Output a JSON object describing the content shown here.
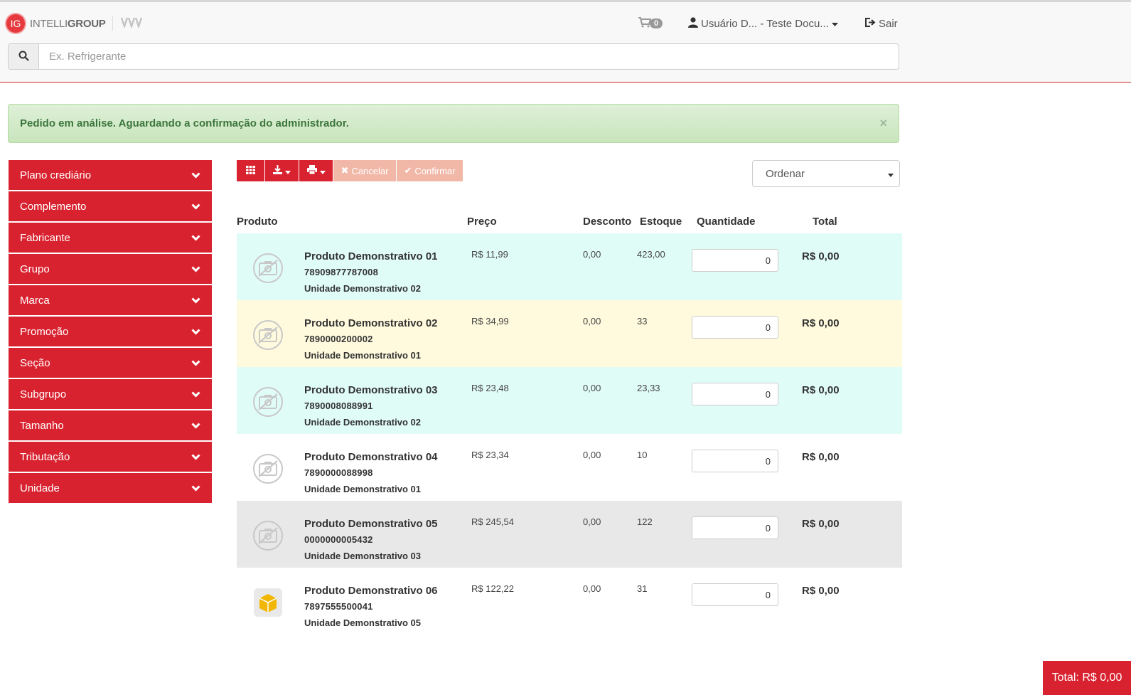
{
  "header": {
    "brand_initials": "IG",
    "brand_name_light": "INTELLI",
    "brand_name_bold": "GROUP",
    "cart_count": "0",
    "user_label": "Usuário D... - Teste Docu...",
    "logout_label": "Sair"
  },
  "search": {
    "placeholder": "Ex. Refrigerante"
  },
  "alert": {
    "message": "Pedido em análise. Aguardando a confirmação do administrador.",
    "close": "×"
  },
  "sidebar": {
    "items": [
      {
        "label": "Plano crediário"
      },
      {
        "label": "Complemento"
      },
      {
        "label": "Fabricante"
      },
      {
        "label": "Grupo"
      },
      {
        "label": "Marca"
      },
      {
        "label": "Promoção"
      },
      {
        "label": "Seção"
      },
      {
        "label": "Subgrupo"
      },
      {
        "label": "Tamanho"
      },
      {
        "label": "Tributação"
      },
      {
        "label": "Unidade"
      }
    ]
  },
  "toolbar": {
    "cancel_label": "Cancelar",
    "confirm_label": "Confirmar",
    "order_label": "Ordenar"
  },
  "table": {
    "headers": {
      "product": "Produto",
      "price": "Preço",
      "discount": "Desconto",
      "stock": "Estoque",
      "quantity": "Quantidade",
      "total": "Total"
    },
    "rows": [
      {
        "name": "Produto Demonstrativo 01",
        "code": "78909877787008",
        "unit": "Unidade Demonstrativo 02",
        "price": "R$ 11,99",
        "discount": "0,00",
        "stock": "423,00",
        "qty": "0",
        "total": "R$ 0,00",
        "bg": "#e0fcf7",
        "icon": "no-image-icon"
      },
      {
        "name": "Produto Demonstrativo 02",
        "code": "7890000200002",
        "unit": "Unidade Demonstrativo 01",
        "price": "R$ 34,99",
        "discount": "0,00",
        "stock": "33",
        "qty": "0",
        "total": "R$ 0,00",
        "bg": "#fffadd",
        "icon": "no-image-icon"
      },
      {
        "name": "Produto Demonstrativo 03",
        "code": "7890008088991",
        "unit": "Unidade Demonstrativo 02",
        "price": "R$ 23,48",
        "discount": "0,00",
        "stock": "23,33",
        "qty": "0",
        "total": "R$ 0,00",
        "bg": "#e0fcf7",
        "icon": "no-image-icon"
      },
      {
        "name": "Produto Demonstrativo 04",
        "code": "7890000088998",
        "unit": "Unidade Demonstrativo 01",
        "price": "R$ 23,34",
        "discount": "0,00",
        "stock": "10",
        "qty": "0",
        "total": "R$ 0,00",
        "bg": "#ffffff",
        "icon": "no-image-icon"
      },
      {
        "name": "Produto Demonstrativo 05",
        "code": "0000000005432",
        "unit": "Unidade Demonstrativo 03",
        "price": "R$ 245,54",
        "discount": "0,00",
        "stock": "122",
        "qty": "0",
        "total": "R$ 0,00",
        "bg": "#e8e8e8",
        "icon": "no-image-icon"
      },
      {
        "name": "Produto Demonstrativo 06",
        "code": "7897555500041",
        "unit": "Unidade Demonstrativo 05",
        "price": "R$ 122,22",
        "discount": "0,00",
        "stock": "31",
        "qty": "0",
        "total": "R$ 0,00",
        "bg": "#ffffff",
        "icon": "product-box-icon"
      }
    ]
  },
  "footer": {
    "total_label": "Total: R$ 0,00"
  },
  "colors": {
    "accent": "#d9222f",
    "accent_disabled": "#f1b8a8",
    "success_bg": "#dff0d8",
    "success_text": "#3c763d"
  }
}
